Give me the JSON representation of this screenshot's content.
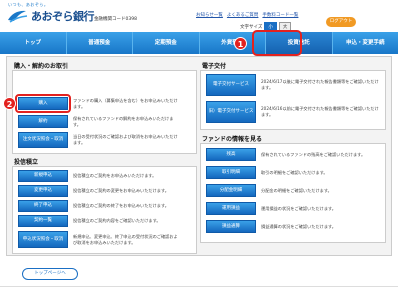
{
  "header": {
    "tagline": "いつも、あおぞら。",
    "bank_name": "あおぞら銀行",
    "bank_code": "金融機関コード0398",
    "links": [
      "お知らせ一覧",
      "よくあるご質問",
      "手数料コード一覧"
    ],
    "font_size_label": "文字サイズ",
    "font_small": "小",
    "font_large": "大",
    "help_label": "ログアウト"
  },
  "nav": {
    "items": [
      "トップ",
      "普通預金",
      "定期預金",
      "外貨預金",
      "投資信託",
      "申込・変更手続"
    ]
  },
  "callouts": {
    "one": "1",
    "two": "2"
  },
  "buy_section": {
    "title": "購入・解約のお取引",
    "rows": [
      {
        "label": "購入",
        "desc": "ファンドの購入（募集申込を含む）をお申込みいただけます。"
      },
      {
        "label": "解約",
        "desc": "保有されているファンドの解約をお申込みいただけます。"
      },
      {
        "label": "注文状況照会・取消",
        "desc": "当日の受付状況のご確認および取消をお申込みいただけます。"
      }
    ]
  },
  "invest_section": {
    "title": "投信積立",
    "rows": [
      {
        "label": "新規申込",
        "desc": "投信積立のご契約をお申込みいただけます。"
      },
      {
        "label": "変更申込",
        "desc": "投信積立のご契約の変更をお申込みいただけます。"
      },
      {
        "label": "終了申込",
        "desc": "投信積立のご契約の終了をお申込みいただけます。"
      },
      {
        "label": "契約一覧",
        "desc": "投信積立のご契約内容をご確認いただけます。"
      },
      {
        "label": "申込状況照会・取消",
        "desc": "新規申込、変更申込、終了申込の受付状況のご確認および取消をお申込みいただけます。"
      }
    ]
  },
  "edelivery_section": {
    "title": "電子交付",
    "rows": [
      {
        "label": "電子交付サービス",
        "desc": "2024/6/17以後に電子交付された報告書類等をご確認いただけます。"
      },
      {
        "label": "旧）電子交付サービス",
        "desc": "2024/6/16以前に電子交付された報告書類等をご確認いただけます。"
      }
    ]
  },
  "fund_section": {
    "title": "ファンドの情報を見る",
    "rows": [
      {
        "label": "残高",
        "desc": "保有されているファンドの残高をご確認いただけます。"
      },
      {
        "label": "取引明細",
        "desc": "取引の明細をご確認いただけます。"
      },
      {
        "label": "分配金明細",
        "desc": "分配金の明細をご確認いただけます。"
      },
      {
        "label": "運用損益",
        "desc": "運用損益の状況をご確認いただけます。"
      },
      {
        "label": "損益通算",
        "desc": "損益通算の状況をご確認いただけます。"
      }
    ]
  },
  "footer": {
    "top_link": "トップページへ"
  },
  "colors": {
    "brand_blue": "#1a6fc4",
    "highlight_red": "#e3221f",
    "orange": "#f19a24"
  }
}
